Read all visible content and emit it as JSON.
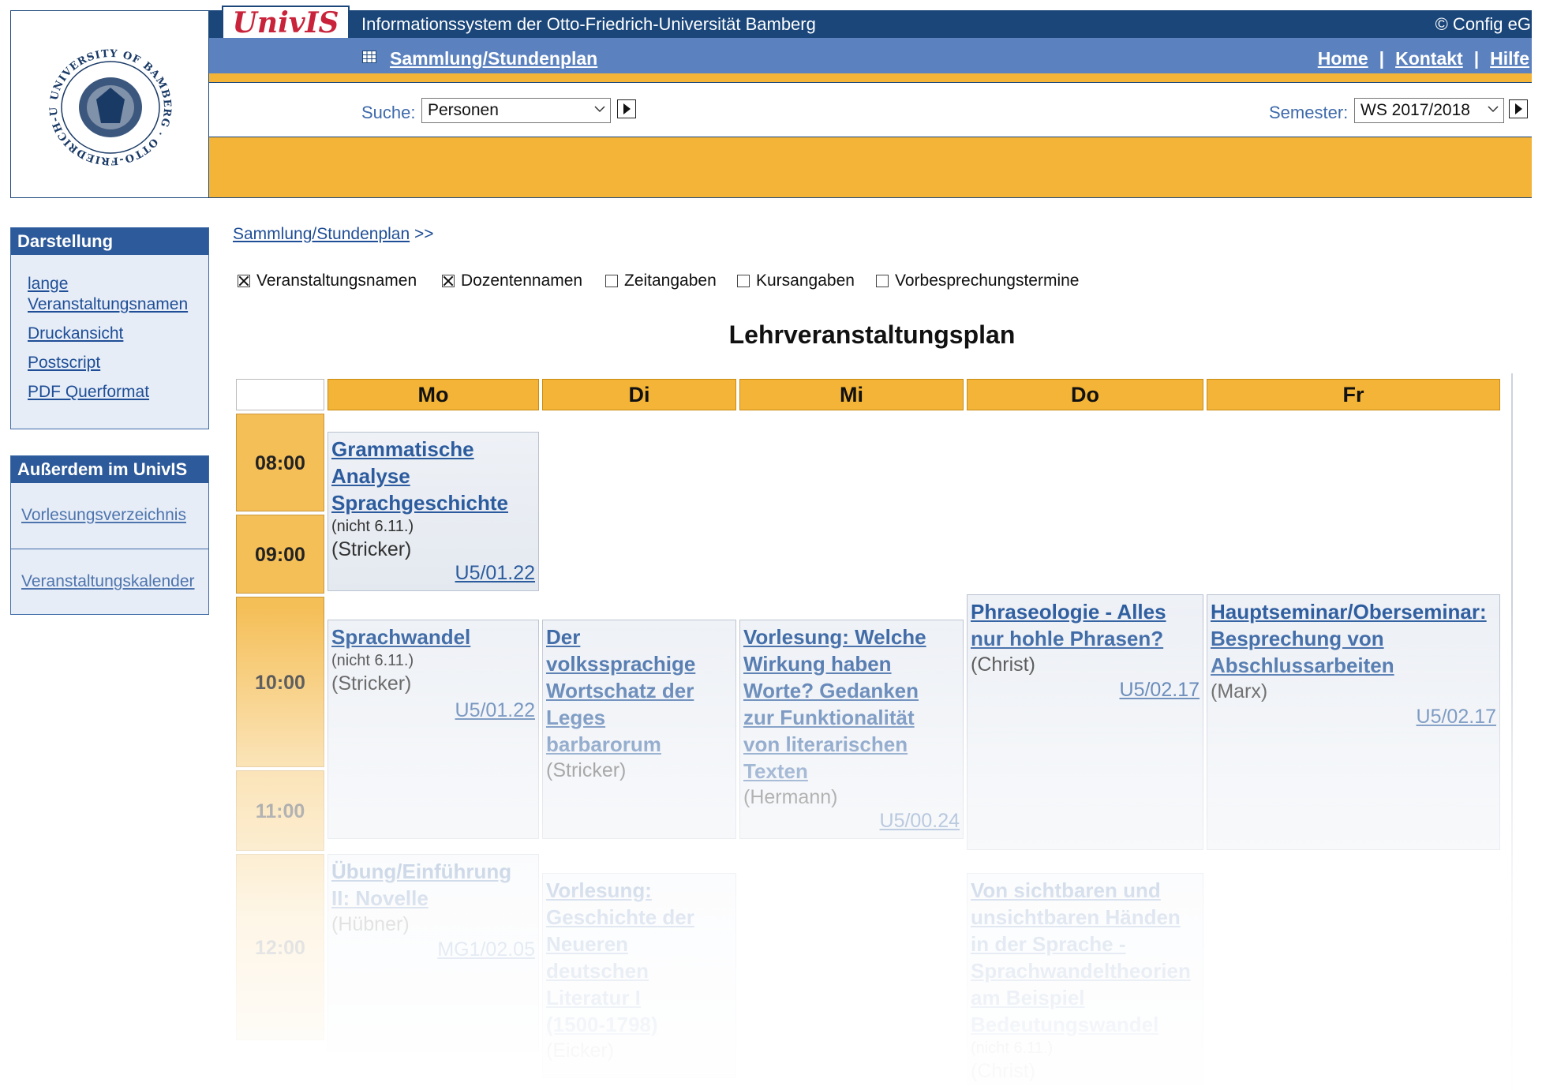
{
  "header": {
    "logo_text": "UnivIS",
    "system_title": "Informationssystem der Otto-Friedrich-Universität Bamberg",
    "copyright": "© Config eG",
    "breadcrumb": "Sammlung/Stundenplan",
    "nav": {
      "home": "Home",
      "contact": "Kontakt",
      "help": "Hilfe",
      "separator": "|"
    },
    "search_label": "Suche:",
    "search_value": "Personen",
    "semester_label": "Semester:",
    "semester_value": "WS 2017/2018"
  },
  "seal_text": "UNIVERSITY OF BAMBERG · OTTO-FRIEDRICH-UNIVERSITÄT BAMBERG",
  "sidebar": {
    "darstellung": {
      "title": "Darstellung",
      "items": [
        "lange",
        "Veranstaltungsnamen",
        "Druckansicht",
        "Postscript",
        "PDF Querformat"
      ]
    },
    "ausserdem": {
      "title": "Außerdem im UnivIS",
      "items": [
        "Vorlesungsverzeichnis",
        "Veranstaltungskalender"
      ]
    }
  },
  "main": {
    "breadcrumb": "Sammlung/Stundenplan",
    "breadcrumb_suffix": ">>",
    "options": [
      {
        "label": "Veranstaltungsnamen",
        "checked": true
      },
      {
        "label": "Dozentennamen",
        "checked": true
      },
      {
        "label": "Zeitangaben",
        "checked": false
      },
      {
        "label": "Kursangaben",
        "checked": false
      },
      {
        "label": "Vorbesprechungstermine",
        "checked": false
      }
    ],
    "title": "Lehrveranstaltungsplan"
  },
  "timetable": {
    "days": [
      "Mo",
      "Di",
      "Mi",
      "Do",
      "Fr"
    ],
    "times": [
      "08:00",
      "09:00",
      "10:00",
      "11:00",
      "12:00"
    ],
    "events": [
      {
        "title_lines": [
          "Grammatische",
          "Analyse",
          "Sprachgeschichte"
        ],
        "note": "(nicht 6.11.)",
        "lecturer": "(Stricker)",
        "room": "U5/01.22"
      },
      {
        "title_lines": [
          "Sprachwandel"
        ],
        "note": "(nicht 6.11.)",
        "lecturer": "(Stricker)",
        "room": "U5/01.22"
      },
      {
        "title_lines": [
          "Der",
          "volkssprachige",
          "Wortschatz der",
          "Leges",
          "barbarorum"
        ],
        "lecturer": "(Stricker)"
      },
      {
        "title_lines": [
          "Vorlesung: Welche",
          "Wirkung haben",
          "Worte? Gedanken",
          "zur Funktionalität",
          "von literarischen",
          "Texten"
        ],
        "lecturer": "(Hermann)",
        "room": "U5/00.24"
      },
      {
        "title_lines": [
          "Phraseologie - Alles",
          "nur hohle Phrasen?"
        ],
        "lecturer": "(Christ)",
        "room": "U5/02.17"
      },
      {
        "title_lines": [
          "Hauptseminar/Oberseminar:",
          "Besprechung von",
          "Abschlussarbeiten"
        ],
        "lecturer": "(Marx)",
        "room": "U5/02.17"
      },
      {
        "title_lines": [
          "Übung/Einführung",
          "II: Novelle"
        ],
        "lecturer": "(Hübner)",
        "room": "MG1/02.05"
      },
      {
        "title_lines": [
          "Vorlesung:",
          "Geschichte der",
          "Neueren",
          "deutschen",
          "Literatur I",
          "(1500-1798)"
        ],
        "lecturer": "(Eicker)"
      },
      {
        "title_lines": [
          "Von sichtbaren und",
          "unsichtbaren Händen",
          "in der Sprache -",
          "Sprachwandeltheorien",
          "am Beispiel",
          "Bedeutungswandel"
        ],
        "note": "(nicht 6.11.)",
        "lecturer": "(Christ)"
      }
    ]
  },
  "colors": {
    "navy": "#1a467a",
    "blue_bar": "#5b82bf",
    "orange": "#f3b437",
    "link": "#1f4e96",
    "logo_red": "#c8233a"
  }
}
